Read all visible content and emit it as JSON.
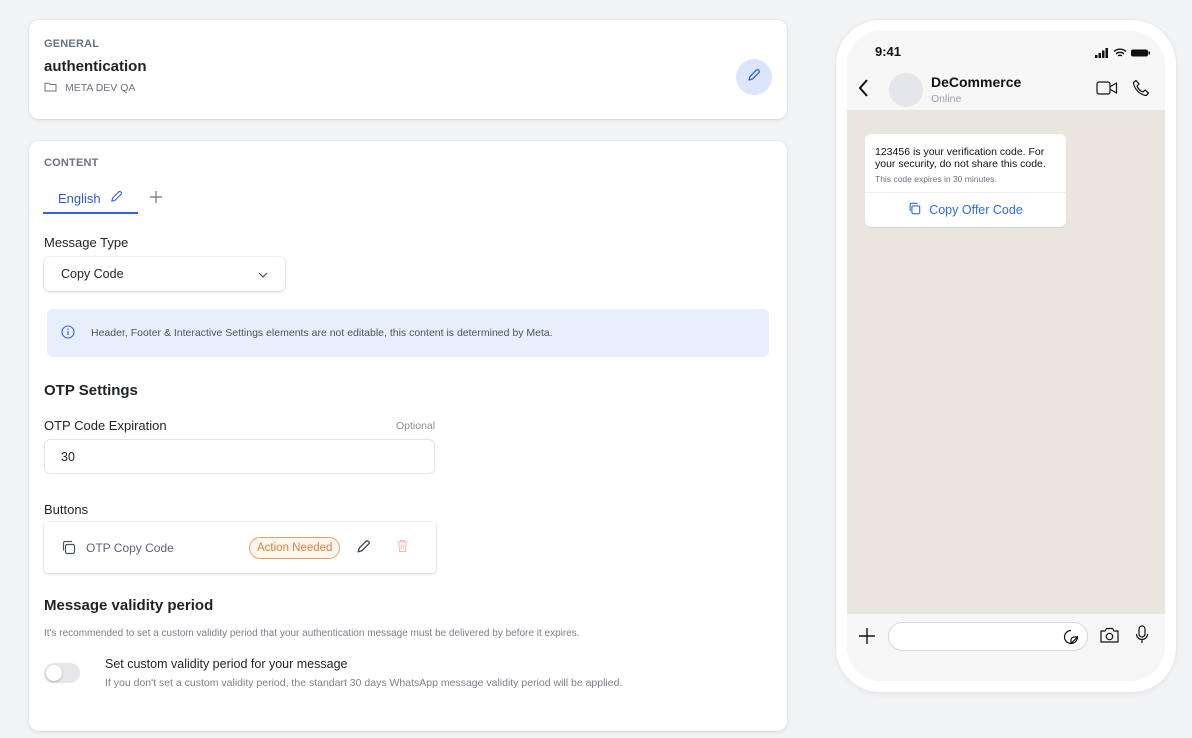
{
  "general": {
    "section_label": "GENERAL",
    "template_name": "authentication",
    "folder_name": "META DEV QA"
  },
  "content": {
    "section_label": "CONTENT",
    "tabs": [
      {
        "label": "English"
      }
    ],
    "message_type": {
      "label": "Message Type",
      "value": "Copy Code"
    },
    "info_text": "Header, Footer & Interactive Settings elements are not editable, this content is determined by Meta.",
    "otp_settings": {
      "heading": "OTP Settings",
      "expiration_label": "OTP Code Expiration",
      "optional_text": "Optional",
      "expiration_value": "30"
    },
    "buttons": {
      "label": "Buttons",
      "items": [
        {
          "label": "OTP Copy Code",
          "badge": "Action Needed"
        }
      ]
    },
    "validity": {
      "heading": "Message validity period",
      "description": "It's recommended to set a custom validity period that your authentication message must be delivered by before it expires.",
      "toggle_title": "Set custom validity period for your message",
      "toggle_description": "If you don't set a custom validity period, the standart 30 days WhatsApp message validity period will be applied.",
      "toggle_on": false
    }
  },
  "preview": {
    "time": "9:41",
    "contact_name": "DeCommerce",
    "contact_status": "Online",
    "message_text": "123456 is your verification code. For your security, do not share this code.",
    "expiry_text": "This code expires in 30 minutes.",
    "copy_button": "Copy Offer Code"
  },
  "colors": {
    "accent": "#2f5bd0",
    "badge_orange": "#d9803f",
    "info_bg": "#e9eefb",
    "chat_bg": "#e9e6df"
  }
}
